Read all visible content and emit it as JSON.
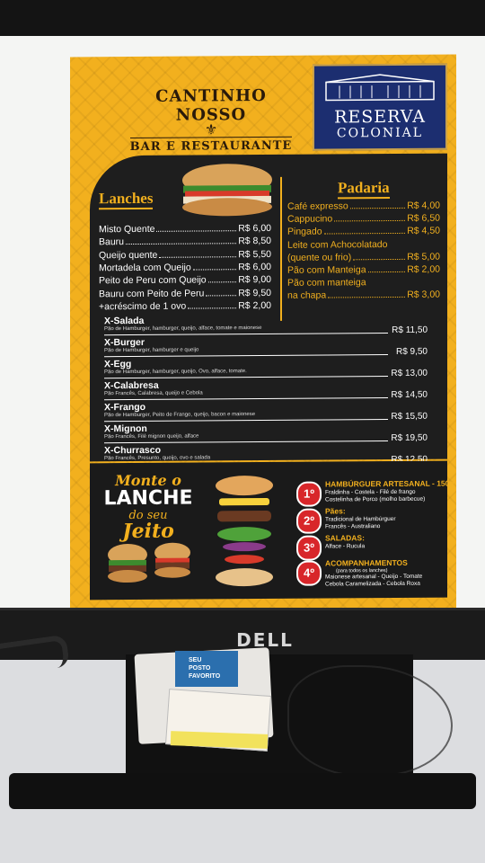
{
  "monitor": {
    "brand": "DELL"
  },
  "desk_box": {
    "label_1": "SEU",
    "label_2": "POSTO",
    "label_3": "FAVORITO"
  },
  "poster": {
    "brand_title": "CANTINHO NOSSO",
    "brand_subtitle": "BAR E RESTAURANTE",
    "logo_line1": "RESERVA",
    "logo_line2": "COLONIAL",
    "lanches_title": "Lanches",
    "lanches": [
      {
        "name": "Misto Quente",
        "price": "R$ 6,00"
      },
      {
        "name": "Bauru",
        "price": "R$ 8,50"
      },
      {
        "name": "Queijo quente",
        "price": "R$ 5,50"
      },
      {
        "name": "Mortadela com Queijo",
        "price": "R$ 6,00"
      },
      {
        "name": "Peito de Peru com Queijo",
        "price": "R$ 9,00"
      },
      {
        "name": "Bauru com Peito de Peru",
        "price": "R$ 9,50"
      },
      {
        "name": "+acréscimo de 1 ovo",
        "price": "R$ 2,00"
      }
    ],
    "padaria_title": "Padaria",
    "padaria": [
      {
        "name": "Café expresso",
        "price": "R$ 4,00"
      },
      {
        "name": "Cappucino",
        "price": "R$ 6,50"
      },
      {
        "name": "Pingado",
        "price": "R$ 4,50"
      },
      {
        "name": "Leite com Achocolatado",
        "price": ""
      },
      {
        "name": "(quente ou frio)",
        "price": "R$ 5,00"
      },
      {
        "name": "Pão com Manteiga",
        "price": "R$ 2,00"
      },
      {
        "name": "Pão com manteiga",
        "price": ""
      },
      {
        "name": "na chapa",
        "price": "R$ 3,00"
      }
    ],
    "x_items": [
      {
        "name": "X-Salada",
        "desc": "Pão de Hamburger, hamburger, queijo, alface, tomate e maionese",
        "price": "R$ 11,50"
      },
      {
        "name": "X-Burger",
        "desc": "Pão de Hamburger, hamburger e queijo",
        "price": "R$ 9,50"
      },
      {
        "name": "X-Egg",
        "desc": "Pão de Hamburger, hamburger, queijo, Ovo, alface, tomate.",
        "price": "R$ 13,00"
      },
      {
        "name": "X-Calabresa",
        "desc": "Pão Francês, Calabresa, queijo e Cebola",
        "price": "R$ 14,50"
      },
      {
        "name": "X-Frango",
        "desc": "Pão de Hamburger, Peito de Frango, queijo, bacon e maionese",
        "price": "R$ 15,50"
      },
      {
        "name": "X-Mignon",
        "desc": "Pão Francês, Filé mignon queijo, alface",
        "price": "R$ 19,50"
      },
      {
        "name": "X-Churrasco",
        "desc": "Pão Francês, Presunto, queijo, ovo e salada",
        "price": "R$ 12,50"
      }
    ],
    "monte": {
      "line1": "Monte o",
      "line2": "LANCHE",
      "line3": "do seu",
      "line4": "Jeito"
    },
    "steps": [
      {
        "num": "1º",
        "title": "HAMBÚRGUER ARTESANAL - 150g",
        "desc1": "Fraldinha - Costela - Filé de frango",
        "desc2": "Costelinha de Porco (molho barbecue)"
      },
      {
        "num": "2º",
        "title": "Pães:",
        "desc1": "Tradicional de Hambúrguer",
        "desc2": "Francês - Australiano"
      },
      {
        "num": "3º",
        "title": "SALADAS:",
        "desc1": "Alface - Rucula",
        "desc2": ""
      },
      {
        "num": "4º",
        "title": "ACOMPANHAMENTOS",
        "note": "(para todos os lanches)",
        "desc1": "Maionese artesanal - Queijo - Tomate",
        "desc2": "Cebola Caramelizada - Cebola Roxa"
      }
    ]
  },
  "colors": {
    "poster_yellow": "#f2b01e",
    "board": "#1e1e1e",
    "badge_red": "#d8262a",
    "logo_blue": "#1c2e70"
  }
}
